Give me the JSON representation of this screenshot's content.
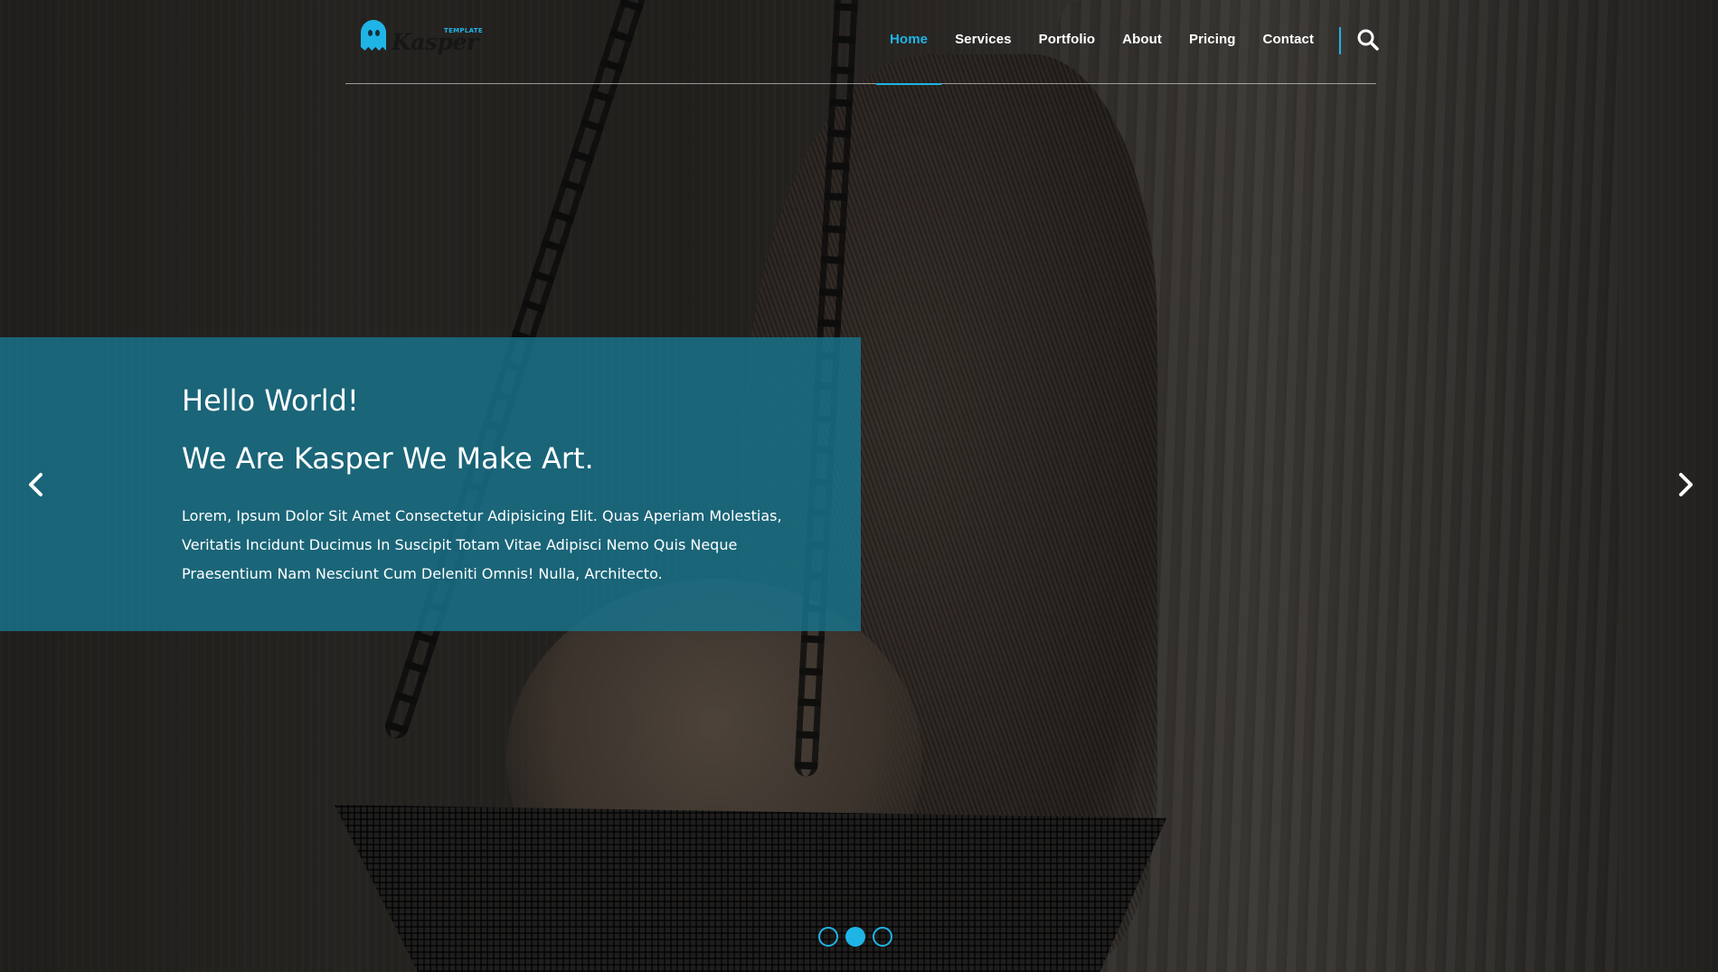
{
  "brand": {
    "name": "Kasper",
    "tag": "TEMPLATE",
    "accent_color": "#1fb4e6"
  },
  "nav": {
    "items": [
      {
        "label": "Home",
        "active": true
      },
      {
        "label": "Services",
        "active": false
      },
      {
        "label": "Portfolio",
        "active": false
      },
      {
        "label": "About",
        "active": false
      },
      {
        "label": "Pricing",
        "active": false
      },
      {
        "label": "Contact",
        "active": false
      }
    ],
    "search_icon": "search-icon"
  },
  "hero": {
    "heading": "Hello World!",
    "subheading": "We Are Kasper We Make Art.",
    "text": "Lorem, Ipsum Dolor Sit Amet Consectetur Adipisicing Elit. Quas Aperiam Molestias, Veritatis Incidunt Ducimus In Suscipit Totam Vitae Adipisci Nemo Quis Neque Praesentium Nam Nesciunt Cum Deleniti Omnis! Nulla, Architecto.",
    "overlay_color": "#18748c"
  },
  "slider": {
    "prev_icon": "chevron-left-icon",
    "next_icon": "chevron-right-icon",
    "bullets": [
      {
        "active": false
      },
      {
        "active": true
      },
      {
        "active": false
      }
    ]
  }
}
